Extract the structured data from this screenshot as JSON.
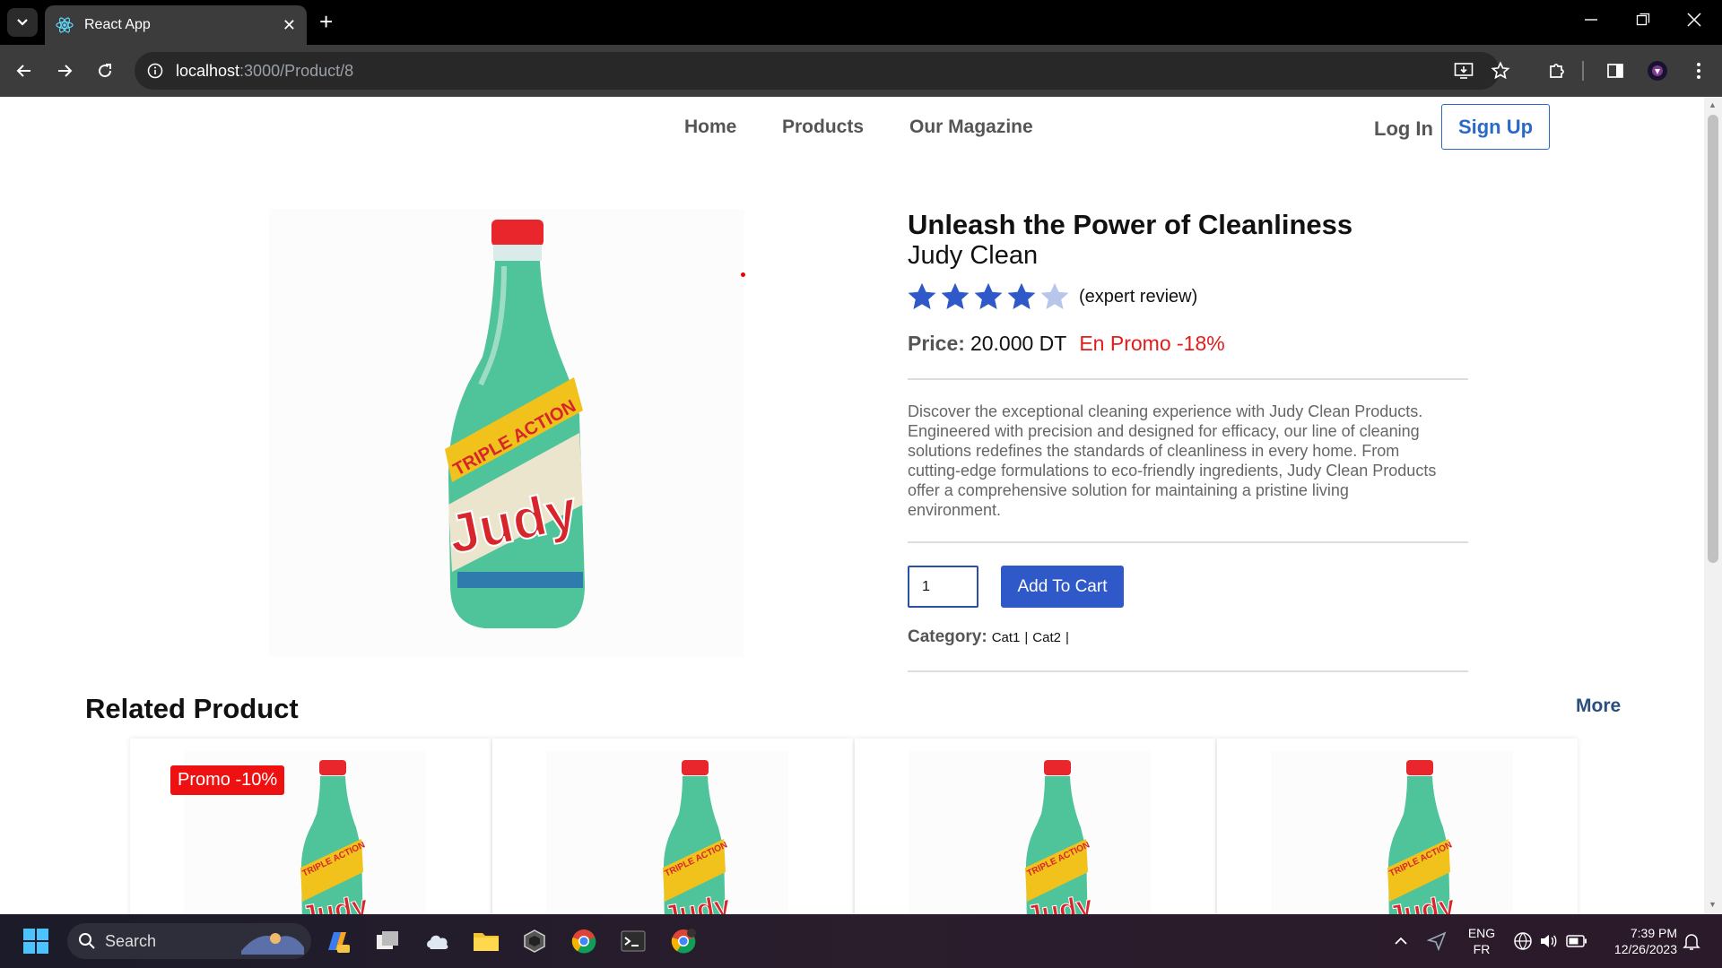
{
  "browser": {
    "tab_title": "React App",
    "url_host": "localhost",
    "url_path": ":3000/Product/8"
  },
  "nav": {
    "home": "Home",
    "products": "Products",
    "magazine": "Our Magazine",
    "login": "Log In",
    "signup": "Sign Up"
  },
  "product": {
    "title": "Unleash the Power of Cleanliness",
    "brand": "Judy Clean",
    "rating": 4,
    "rating_max": 5,
    "review_label": "(expert review)",
    "price_label": "Price:",
    "price": "20.000 DT",
    "promo": "En Promo -18%",
    "description": "Discover the exceptional cleaning experience with Judy Clean Products. Engineered with precision and designed for efficacy, our line of cleaning solutions redefines the standards of cleanliness in every home. From cutting-edge formulations to eco-friendly ingredients, Judy Clean Products offer a comprehensive solution for maintaining a pristine living environment.",
    "quantity": "1",
    "add_to_cart": "Add To Cart",
    "category_label": "Category:",
    "categories": [
      "Cat1",
      "Cat2"
    ],
    "image_text_top": "TRIPLE ACTION",
    "image_text_brand": "Judy"
  },
  "related": {
    "title": "Related Product",
    "more": "More",
    "promo_badge": "Promo -10%",
    "card_image_text_top": "TRIPLE ACTION",
    "card_image_text_brand": "Judy"
  },
  "taskbar": {
    "search_placeholder": "Search",
    "lang_top": "ENG",
    "lang_bottom": "FR",
    "time": "7:39 PM",
    "date": "12/26/2023"
  },
  "colors": {
    "accent": "#2f58c8",
    "promo": "#e21b1b",
    "star_filled": "#2f58c8",
    "star_empty": "#b7c6ea"
  }
}
